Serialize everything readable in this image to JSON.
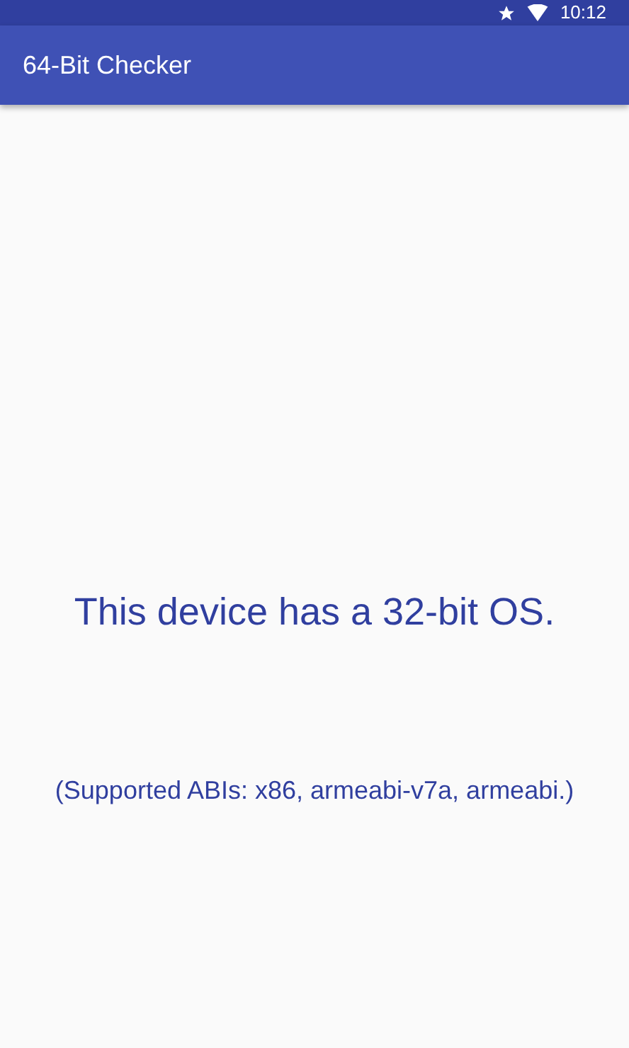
{
  "status_bar": {
    "time": "10:12"
  },
  "app_bar": {
    "title": "64-Bit Checker"
  },
  "result": {
    "headline": "This device has a 32-bit OS.",
    "abis": "(Supported ABIs: x86, armeabi-v7a, armeabi.)"
  }
}
